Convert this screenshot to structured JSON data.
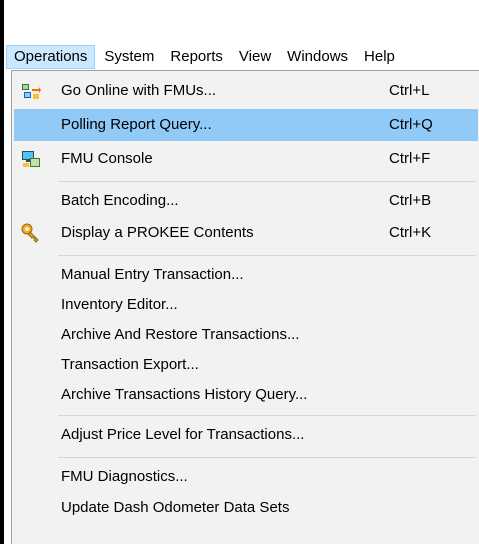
{
  "menubar": {
    "items": [
      {
        "label": "Operations"
      },
      {
        "label": "System"
      },
      {
        "label": "Reports"
      },
      {
        "label": "View"
      },
      {
        "label": "Windows"
      },
      {
        "label": "Help"
      }
    ]
  },
  "operations_menu": {
    "items": [
      {
        "label": "Go Online with FMUs...",
        "shortcut": "Ctrl+L",
        "icon": "go-online-icon"
      },
      {
        "label": "Polling Report Query...",
        "shortcut": "Ctrl+Q"
      },
      {
        "label": "FMU Console",
        "shortcut": "Ctrl+F",
        "icon": "fmu-console-icon"
      },
      {
        "label": "Batch Encoding...",
        "shortcut": "Ctrl+B"
      },
      {
        "label": "Display a PROKEE Contents",
        "shortcut": "Ctrl+K",
        "icon": "key-icon"
      },
      {
        "label": "Manual Entry Transaction..."
      },
      {
        "label": "Inventory Editor..."
      },
      {
        "label": "Archive And Restore Transactions..."
      },
      {
        "label": "Transaction Export..."
      },
      {
        "label": "Archive Transactions History Query..."
      },
      {
        "label": "Adjust Price Level for Transactions..."
      },
      {
        "label": "FMU Diagnostics..."
      },
      {
        "label": "Update Dash Odometer Data Sets"
      }
    ]
  },
  "colors": {
    "highlight": "#91c9f7",
    "menu_active": "#cce8ff",
    "menu_background": "#f2f2f2"
  }
}
